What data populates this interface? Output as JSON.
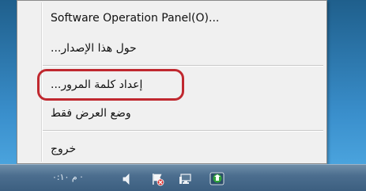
{
  "menu": {
    "items": [
      {
        "label": "Software Operation Panel(O)..."
      },
      {
        "label": "...حول هذا الإصدار"
      },
      {
        "label": "...إعداد كلمة المرور"
      },
      {
        "label": "وضع العرض فقط"
      },
      {
        "label": "خروج"
      }
    ]
  },
  "taskbar": {
    "clock": "م ٠:١٠ ·",
    "icons": [
      "speaker-icon",
      "action-center-flag-icon",
      "network-icon",
      "scanner-app-icon"
    ]
  },
  "colors": {
    "highlight": "#c0282f",
    "menu_bg": "#f0f0f0",
    "desktop": "#2e7ab0",
    "taskbar": "#4c6e8f"
  }
}
